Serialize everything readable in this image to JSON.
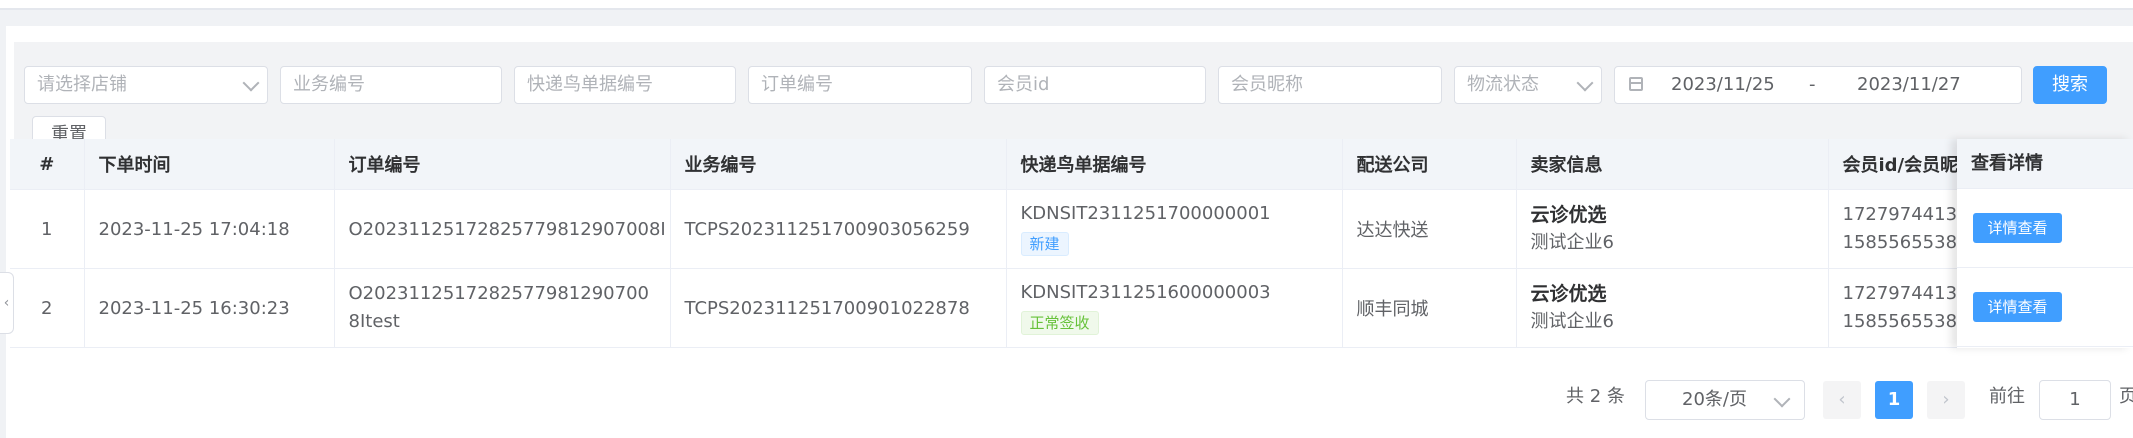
{
  "filters": {
    "shop_placeholder": "请选择店铺",
    "business_no_placeholder": "业务编号",
    "kdn_no_placeholder": "快递鸟单据编号",
    "order_no_placeholder": "订单编号",
    "member_id_placeholder": "会员id",
    "member_nick_placeholder": "会员昵称",
    "logistics_status_placeholder": "物流状态",
    "date_start": "2023/11/25",
    "date_sep": "-",
    "date_end": "2023/11/27",
    "search_label": "搜索",
    "reset_label": "重置"
  },
  "table": {
    "headers": {
      "index": "#",
      "order_time": "下单时间",
      "order_no": "订单编号",
      "business_no": "业务编号",
      "kdn_no": "快递鸟单据编号",
      "carrier": "配送公司",
      "seller": "卖家信息",
      "member": "会员id/会员昵",
      "detail": "查看详情"
    },
    "rows": [
      {
        "index": "1",
        "order_time": "2023-11-25 17:04:18",
        "order_no": "O20231125172825779812907008I",
        "business_no": "TCPS202311251700903056259",
        "kdn_no": "KDNSIT2311251700000001",
        "status": "新建",
        "carrier": "达达快送",
        "seller_name": "云诊优选",
        "seller_company": "测试企业6",
        "member_id": "1727974413",
        "member_phone": "1585565538",
        "detail_label": "详情查看"
      },
      {
        "index": "2",
        "order_time": "2023-11-25 16:30:23",
        "order_no": "O20231125172825779812907008Itest",
        "business_no": "TCPS202311251700901022878",
        "kdn_no": "KDNSIT2311251600000003",
        "status": "正常签收",
        "carrier": "顺丰同城",
        "seller_name": "云诊优选",
        "seller_company": "测试企业6",
        "member_id": "1727974413",
        "member_phone": "1585565538",
        "detail_label": "详情查看"
      }
    ]
  },
  "pagination": {
    "total": "共 2 条",
    "page_size": "20条/页",
    "current": "1",
    "goto_label": "前往",
    "goto_value": "1",
    "page_suffix": "页"
  },
  "colors": {
    "primary": "#409eff",
    "tag_new": "#409eff",
    "tag_success": "#67c23a"
  }
}
